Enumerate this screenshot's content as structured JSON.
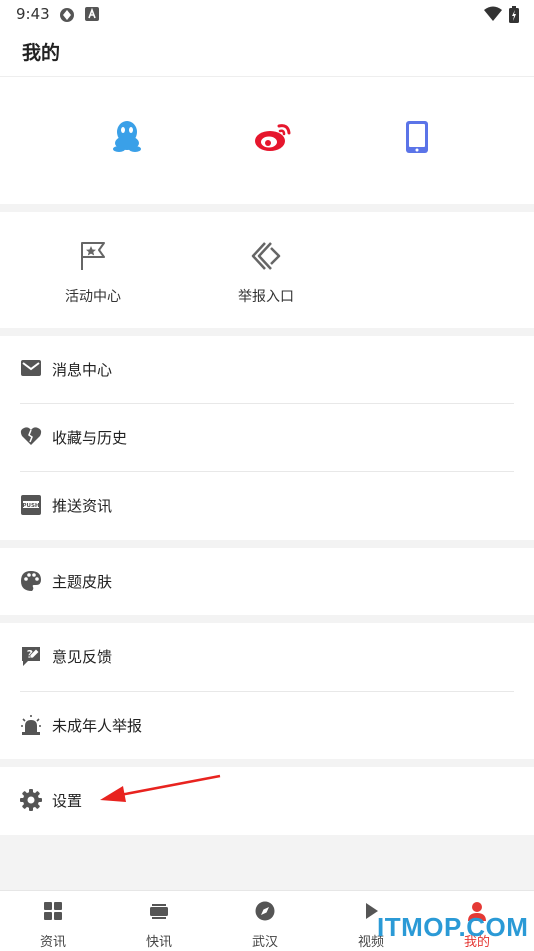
{
  "status_bar": {
    "time": "9:43"
  },
  "header": {
    "title": "我的"
  },
  "login": {
    "options": [
      {
        "icon": "qq-icon",
        "color": "#3aa0e8"
      },
      {
        "icon": "weibo-icon",
        "color": "#e6162d"
      },
      {
        "icon": "phone-icon",
        "color": "#5b74e8"
      }
    ]
  },
  "quick": {
    "activity_label": "活动中心",
    "report_label": "举报入口"
  },
  "menu": {
    "messages": "消息中心",
    "favorites": "收藏与历史",
    "push": "推送资讯",
    "theme": "主题皮肤",
    "feedback": "意见反馈",
    "minor_report": "未成年人举报",
    "settings": "设置"
  },
  "tabs": [
    {
      "label": "资讯",
      "icon": "grid-icon"
    },
    {
      "label": "快讯",
      "icon": "stack-icon"
    },
    {
      "label": "武汉",
      "icon": "compass-icon"
    },
    {
      "label": "视频",
      "icon": "play-icon"
    },
    {
      "label": "我的",
      "icon": "person-icon",
      "active": true
    }
  ],
  "watermark": "ITMOP.COM",
  "colors": {
    "accent": "#e53935",
    "background": "#f3f3f3"
  }
}
